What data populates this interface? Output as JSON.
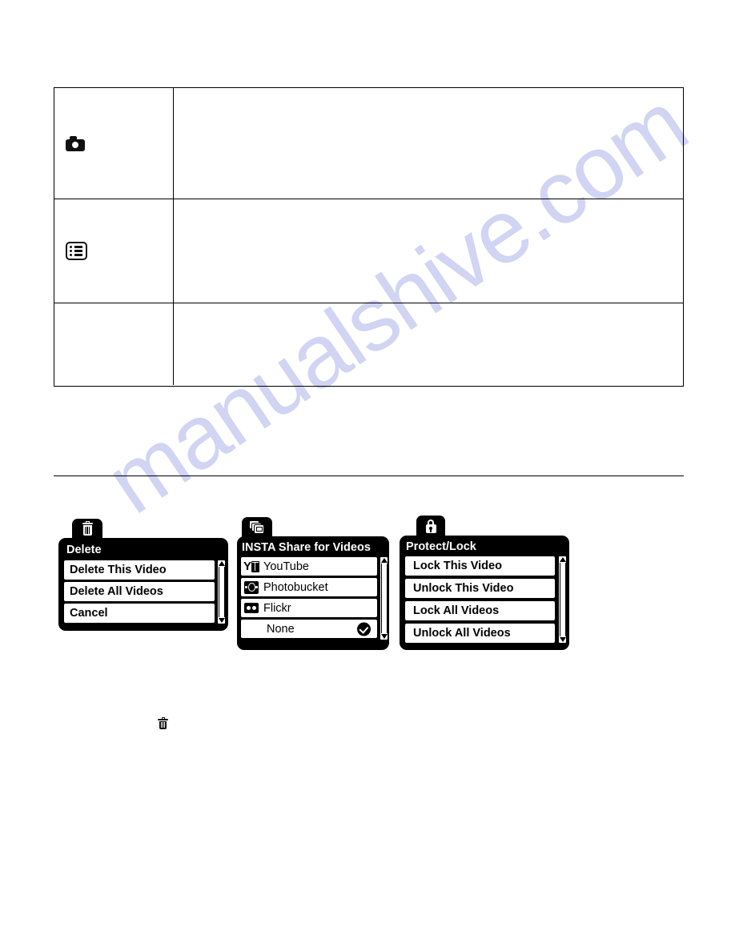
{
  "watermark": {
    "text": "manualshive.com"
  },
  "spec_table": {
    "rows": [
      {
        "icon": "camera-icon",
        "description": ""
      },
      {
        "icon": "list-icon",
        "description": ""
      },
      {
        "icon": "",
        "description": ""
      }
    ]
  },
  "inline_icons": [
    {
      "name": "trash-icon"
    }
  ],
  "menus": [
    {
      "id": "delete",
      "tab_icon": "trash-icon",
      "title": "Delete",
      "items": [
        {
          "label": "Delete This Video",
          "selected": false
        },
        {
          "label": "Delete All Videos",
          "selected": false
        },
        {
          "label": "Cancel",
          "selected": false
        }
      ],
      "scrollbar": true
    },
    {
      "id": "insta-share",
      "tab_icon": "stacked-photos-icon",
      "title": "INSTA Share for Videos",
      "items": [
        {
          "label": "YouTube",
          "icon": "youtube-icon",
          "selected": false
        },
        {
          "label": "Photobucket",
          "icon": "photobucket-icon",
          "selected": false
        },
        {
          "label": "Flickr",
          "icon": "flickr-icon",
          "selected": false
        },
        {
          "label": "None",
          "icon": "",
          "selected": true
        }
      ],
      "scrollbar": true
    },
    {
      "id": "protect-lock",
      "tab_icon": "lock-icon",
      "title": "Protect/Lock",
      "items": [
        {
          "label": "Lock This Video",
          "selected": false
        },
        {
          "label": "Unlock This Video",
          "selected": false
        },
        {
          "label": "Lock All Videos",
          "selected": false
        },
        {
          "label": "Unlock All Videos",
          "selected": false
        }
      ],
      "scrollbar": true
    }
  ],
  "colors": {
    "menu_background": "#000000",
    "menu_item_background": "#ffffff",
    "text": "#000000",
    "title_text": "#ffffff",
    "watermark": "#c9cdf0",
    "rule": "#000000"
  }
}
